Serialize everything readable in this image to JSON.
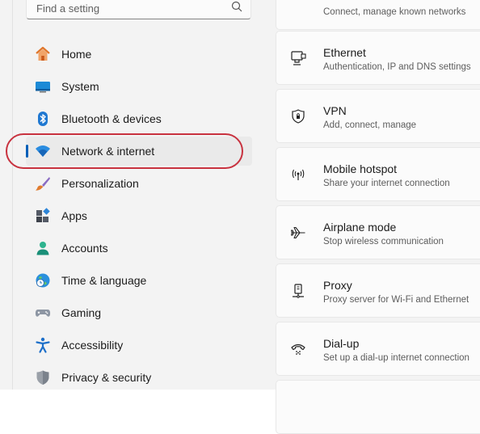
{
  "search": {
    "placeholder": "Find a setting"
  },
  "nav": {
    "items": [
      {
        "label": "Home",
        "icon": "home-icon"
      },
      {
        "label": "System",
        "icon": "system-icon"
      },
      {
        "label": "Bluetooth & devices",
        "icon": "bluetooth-icon"
      },
      {
        "label": "Network & internet",
        "icon": "wifi-icon",
        "selected": true
      },
      {
        "label": "Personalization",
        "icon": "brush-icon"
      },
      {
        "label": "Apps",
        "icon": "apps-icon"
      },
      {
        "label": "Accounts",
        "icon": "accounts-icon"
      },
      {
        "label": "Time & language",
        "icon": "time-language-icon"
      },
      {
        "label": "Gaming",
        "icon": "gamepad-icon"
      },
      {
        "label": "Accessibility",
        "icon": "accessibility-icon"
      },
      {
        "label": "Privacy & security",
        "icon": "shield-icon"
      }
    ]
  },
  "cards": [
    {
      "title": "",
      "subtitle": "Connect, manage known networks",
      "icon": ""
    },
    {
      "title": "Ethernet",
      "subtitle": "Authentication, IP and DNS settings",
      "icon": "ethernet-icon"
    },
    {
      "title": "VPN",
      "subtitle": "Add, connect, manage",
      "icon": "vpn-icon"
    },
    {
      "title": "Mobile hotspot",
      "subtitle": "Share your internet connection",
      "icon": "hotspot-icon"
    },
    {
      "title": "Airplane mode",
      "subtitle": "Stop wireless communication",
      "icon": "airplane-icon"
    },
    {
      "title": "Proxy",
      "subtitle": "Proxy server for Wi-Fi and Ethernet",
      "icon": "proxy-icon"
    },
    {
      "title": "Dial-up",
      "subtitle": "Set up a dial-up internet connection",
      "icon": "dialup-icon"
    }
  ],
  "colors": {
    "accent": "#005fb8",
    "highlight": "#c8323f"
  }
}
